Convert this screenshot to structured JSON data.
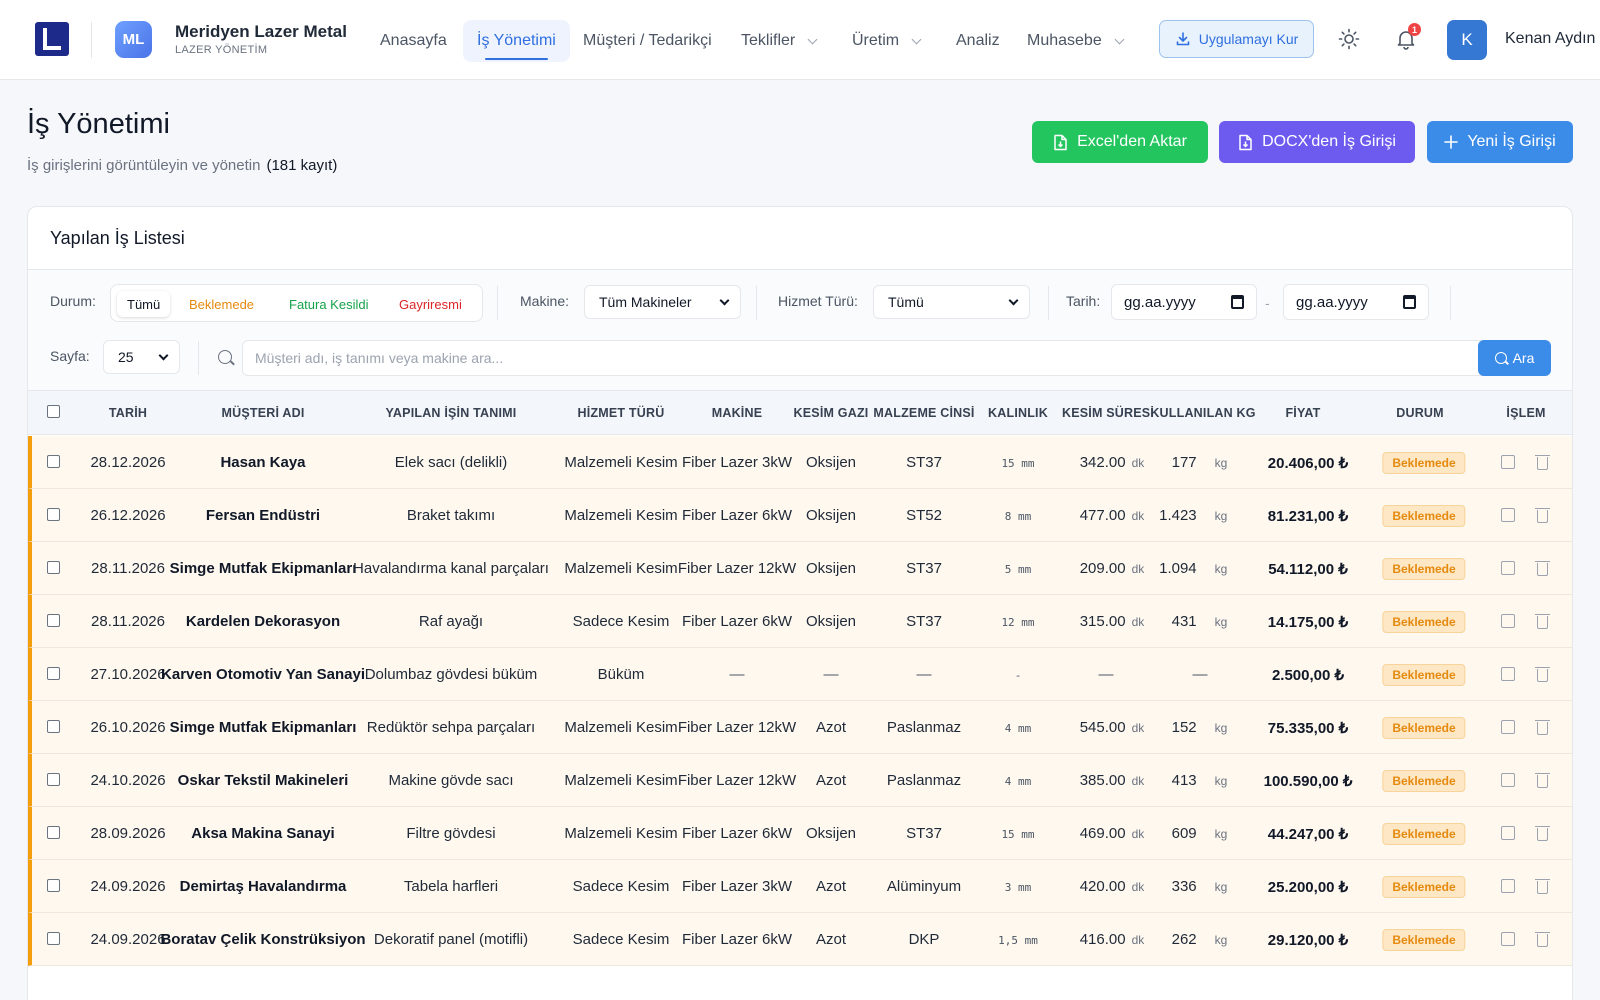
{
  "brand": {
    "badge": "ML",
    "name": "Meridyen Lazer Metal",
    "subtitle": "LAZER YÖNETİM"
  },
  "nav": {
    "items": [
      {
        "label": "Anasayfa"
      },
      {
        "label": "İş Yönetimi"
      },
      {
        "label": "Müşteri / Tedarikçi"
      },
      {
        "label": "Teklifler"
      },
      {
        "label": "Üretim"
      },
      {
        "label": "Analiz"
      },
      {
        "label": "Muhasebe"
      }
    ],
    "active": "İş Yönetimi",
    "install_label": "Uygulamayı Kur",
    "notification_count": "1",
    "user_initial": "K",
    "user_name": "Kenan Aydın"
  },
  "page": {
    "title": "İş Yönetimi",
    "subtitle": "İş girişlerini görüntüleyin ve yönetin",
    "record_count": "(181 kayıt)",
    "buttons": {
      "excel": "Excel'den Aktar",
      "docx": "DOCX'den İş Girişi",
      "new": "Yeni İş Girişi"
    }
  },
  "card": {
    "title": "Yapılan İş Listesi",
    "filters": {
      "status_label": "Durum:",
      "status_options": {
        "all": "Tümü",
        "waiting": "Beklemede",
        "invoiced": "Fatura Kesildi",
        "informal": "Gayriresmi"
      },
      "status_selected": "Tümü",
      "machine_label": "Makine:",
      "machine_value": "Tüm Makineler",
      "service_label": "Hizmet Türü:",
      "service_value": "Tümü",
      "date_label": "Tarih:",
      "date_from_placeholder": "gg.aa.yyyy",
      "date_sep": "-",
      "date_to_placeholder": "gg.aa.yyyy",
      "page_label": "Sayfa:",
      "page_size": "25",
      "search_placeholder": "Müşteri adı, iş tanımı veya makine ara...",
      "search_button": "Ara"
    },
    "table": {
      "headers": {
        "date": "TARİH",
        "customer": "MÜŞTERİ ADI",
        "desc": "YAPILAN İŞİN TANIMI",
        "service": "HİZMET TÜRÜ",
        "machine": "MAKİNE",
        "gas": "KESİM GAZI",
        "material": "MALZEME CİNSİ",
        "thickness": "KALINLIK",
        "duration": "KESİM SÜRESİ",
        "kg": "KULLANILAN KG",
        "price": "FİYAT",
        "status": "DURUM",
        "action": "İŞLEM"
      },
      "units": {
        "thickness": "mm",
        "duration": "dk",
        "kg": "kg"
      },
      "rows": [
        {
          "date": "28.12.2026",
          "customer": "Hasan Kaya",
          "desc": "Elek sacı (delikli)",
          "service": "Malzemeli Kesim",
          "machine": "Fiber Lazer 3kW",
          "gas": "Oksijen",
          "material": "ST37",
          "thickness": "15",
          "duration": "342.00",
          "kg": "177",
          "price": "20.406,00 ₺",
          "status": "Beklemede"
        },
        {
          "date": "26.12.2026",
          "customer": "Fersan Endüstri",
          "desc": "Braket takımı",
          "service": "Malzemeli Kesim",
          "machine": "Fiber Lazer 6kW",
          "gas": "Oksijen",
          "material": "ST52",
          "thickness": "8",
          "duration": "477.00",
          "kg": "1.423",
          "price": "81.231,00 ₺",
          "status": "Beklemede"
        },
        {
          "date": "28.11.2026",
          "customer": "Simge Mutfak Ekipmanları",
          "desc": "Havalandırma kanal parçaları",
          "service": "Malzemeli Kesim",
          "machine": "Fiber Lazer 12kW",
          "gas": "Oksijen",
          "material": "ST37",
          "thickness": "5",
          "duration": "209.00",
          "kg": "1.094",
          "price": "54.112,00 ₺",
          "status": "Beklemede"
        },
        {
          "date": "28.11.2026",
          "customer": "Kardelen Dekorasyon",
          "desc": "Raf ayağı",
          "service": "Sadece Kesim",
          "machine": "Fiber Lazer 6kW",
          "gas": "Oksijen",
          "material": "ST37",
          "thickness": "12",
          "duration": "315.00",
          "kg": "431",
          "price": "14.175,00 ₺",
          "status": "Beklemede"
        },
        {
          "date": "27.10.2026",
          "customer": "Karven Otomotiv Yan Sanayi",
          "desc": "Dolumbaz gövdesi büküm",
          "service": "Büküm",
          "machine": "—",
          "gas": "—",
          "material": "—",
          "thickness": "-",
          "duration": "—",
          "kg": "—",
          "price": "2.500,00 ₺",
          "status": "Beklemede"
        },
        {
          "date": "26.10.2026",
          "customer": "Simge Mutfak Ekipmanları",
          "desc": "Redüktör sehpa parçaları",
          "service": "Malzemeli Kesim",
          "machine": "Fiber Lazer 12kW",
          "gas": "Azot",
          "material": "Paslanmaz",
          "thickness": "4",
          "duration": "545.00",
          "kg": "152",
          "price": "75.335,00 ₺",
          "status": "Beklemede"
        },
        {
          "date": "24.10.2026",
          "customer": "Oskar Tekstil Makineleri",
          "desc": "Makine gövde sacı",
          "service": "Malzemeli Kesim",
          "machine": "Fiber Lazer 12kW",
          "gas": "Azot",
          "material": "Paslanmaz",
          "thickness": "4",
          "duration": "385.00",
          "kg": "413",
          "price": "100.590,00 ₺",
          "status": "Beklemede"
        },
        {
          "date": "28.09.2026",
          "customer": "Aksa Makina Sanayi",
          "desc": "Filtre gövdesi",
          "service": "Malzemeli Kesim",
          "machine": "Fiber Lazer 6kW",
          "gas": "Oksijen",
          "material": "ST37",
          "thickness": "15",
          "duration": "469.00",
          "kg": "609",
          "price": "44.247,00 ₺",
          "status": "Beklemede"
        },
        {
          "date": "24.09.2026",
          "customer": "Demirtaş Havalandırma",
          "desc": "Tabela harfleri",
          "service": "Sadece Kesim",
          "machine": "Fiber Lazer 3kW",
          "gas": "Azot",
          "material": "Alüminyum",
          "thickness": "3",
          "duration": "420.00",
          "kg": "336",
          "price": "25.200,00 ₺",
          "status": "Beklemede"
        },
        {
          "date": "24.09.2026",
          "customer": "Boratav Çelik Konstrüksiyon",
          "desc": "Dekoratif panel (motifli)",
          "service": "Sadece Kesim",
          "machine": "Fiber Lazer 6kW",
          "gas": "Azot",
          "material": "DKP",
          "thickness": "1,5",
          "duration": "416.00",
          "kg": "262",
          "price": "29.120,00 ₺",
          "status": "Beklemede"
        }
      ]
    }
  },
  "colors": {
    "accent": "#2f6fe0",
    "excel": "#22c55e",
    "docx": "#6d5bf0",
    "primary_button": "#3b8be8",
    "pending": "#f59e0b"
  }
}
